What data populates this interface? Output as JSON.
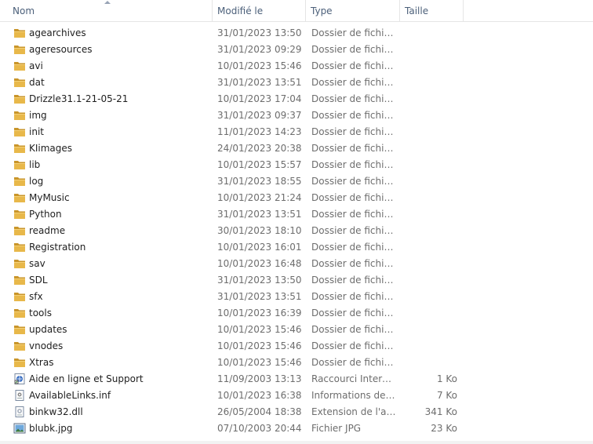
{
  "header": {
    "name": "Nom",
    "date": "Modifié le",
    "type": "Type",
    "size": "Taille"
  },
  "files": [
    {
      "name": "agearchives",
      "date": "31/01/2023 13:50",
      "type": "Dossier de fichiers",
      "size": "",
      "icon": "folder-icon"
    },
    {
      "name": "ageresources",
      "date": "31/01/2023 09:29",
      "type": "Dossier de fichiers",
      "size": "",
      "icon": "folder-icon"
    },
    {
      "name": "avi",
      "date": "10/01/2023 15:46",
      "type": "Dossier de fichiers",
      "size": "",
      "icon": "folder-icon"
    },
    {
      "name": "dat",
      "date": "31/01/2023 13:51",
      "type": "Dossier de fichiers",
      "size": "",
      "icon": "folder-icon"
    },
    {
      "name": "Drizzle31.1-21-05-21",
      "date": "10/01/2023 17:04",
      "type": "Dossier de fichiers",
      "size": "",
      "icon": "folder-icon"
    },
    {
      "name": "img",
      "date": "31/01/2023 09:37",
      "type": "Dossier de fichiers",
      "size": "",
      "icon": "folder-icon"
    },
    {
      "name": "init",
      "date": "11/01/2023 14:23",
      "type": "Dossier de fichiers",
      "size": "",
      "icon": "folder-icon"
    },
    {
      "name": "KIimages",
      "date": "24/01/2023 20:38",
      "type": "Dossier de fichiers",
      "size": "",
      "icon": "folder-icon"
    },
    {
      "name": "lib",
      "date": "10/01/2023 15:57",
      "type": "Dossier de fichiers",
      "size": "",
      "icon": "folder-icon"
    },
    {
      "name": "log",
      "date": "31/01/2023 18:55",
      "type": "Dossier de fichiers",
      "size": "",
      "icon": "folder-icon"
    },
    {
      "name": "MyMusic",
      "date": "10/01/2023 21:24",
      "type": "Dossier de fichiers",
      "size": "",
      "icon": "folder-icon"
    },
    {
      "name": "Python",
      "date": "31/01/2023 13:51",
      "type": "Dossier de fichiers",
      "size": "",
      "icon": "folder-icon"
    },
    {
      "name": "readme",
      "date": "30/01/2023 18:10",
      "type": "Dossier de fichiers",
      "size": "",
      "icon": "folder-icon"
    },
    {
      "name": "Registration",
      "date": "10/01/2023 16:01",
      "type": "Dossier de fichiers",
      "size": "",
      "icon": "folder-icon"
    },
    {
      "name": "sav",
      "date": "10/01/2023 16:48",
      "type": "Dossier de fichiers",
      "size": "",
      "icon": "folder-icon"
    },
    {
      "name": "SDL",
      "date": "31/01/2023 13:50",
      "type": "Dossier de fichiers",
      "size": "",
      "icon": "folder-icon"
    },
    {
      "name": "sfx",
      "date": "31/01/2023 13:51",
      "type": "Dossier de fichiers",
      "size": "",
      "icon": "folder-icon"
    },
    {
      "name": "tools",
      "date": "10/01/2023 16:39",
      "type": "Dossier de fichiers",
      "size": "",
      "icon": "folder-icon"
    },
    {
      "name": "updates",
      "date": "10/01/2023 15:46",
      "type": "Dossier de fichiers",
      "size": "",
      "icon": "folder-icon"
    },
    {
      "name": "vnodes",
      "date": "10/01/2023 15:46",
      "type": "Dossier de fichiers",
      "size": "",
      "icon": "folder-icon"
    },
    {
      "name": "Xtras",
      "date": "10/01/2023 15:46",
      "type": "Dossier de fichiers",
      "size": "",
      "icon": "folder-icon"
    },
    {
      "name": "Aide en ligne et Support",
      "date": "11/09/2003 13:13",
      "type": "Raccourci Internet",
      "size": "1 Ko",
      "icon": "internet-shortcut-icon"
    },
    {
      "name": "AvailableLinks.inf",
      "date": "10/01/2023 16:38",
      "type": "Informations de c...",
      "size": "7 Ko",
      "icon": "setup-info-file-icon"
    },
    {
      "name": "binkw32.dll",
      "date": "26/05/2004 18:38",
      "type": "Extension de l'app...",
      "size": "341 Ko",
      "icon": "dll-file-icon"
    },
    {
      "name": "blubk.jpg",
      "date": "07/10/2003 20:44",
      "type": "Fichier JPG",
      "size": "23 Ko",
      "icon": "image-file-icon"
    }
  ],
  "colors": {
    "header_text": "#4c607a",
    "folder_yellow": "#e8b84a",
    "folder_dark": "#c9952a",
    "meta_text": "#6d6d6d"
  }
}
